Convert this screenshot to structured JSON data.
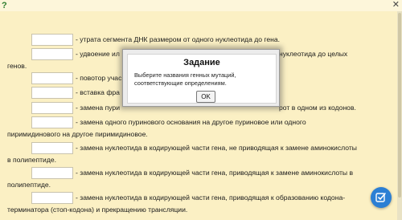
{
  "icons": {
    "help": "?",
    "close": "✕",
    "edit_check": "edit-check-icon"
  },
  "rows": [
    {
      "id": "r1",
      "text": "- утрата сегмента ДНК размером от одного нуклеотида до гена."
    },
    {
      "id": "r2",
      "text": "- удвоение ил",
      "hidden_tail": "нуклеотида до целых"
    },
    {
      "id": "r2b",
      "text": "генов."
    },
    {
      "id": "r3",
      "text": "- повотор учас"
    },
    {
      "id": "r4",
      "text": "- вставка фра"
    },
    {
      "id": "r5",
      "text": "- замена пури",
      "hidden_tail": "рот в одном из кодонов."
    },
    {
      "id": "r6",
      "text": "- замена одного пуринового основания на другое пуриновое или одного"
    },
    {
      "id": "r6b",
      "text": "пиримидинового на другое пиримидиновое."
    },
    {
      "id": "r7",
      "text": "- замена нуклеотида в кодирующей части гена, не приводящая к замене аминокислоты"
    },
    {
      "id": "r7b",
      "text": "в полипептиде."
    },
    {
      "id": "r8",
      "text": "- замена нуклеотида в кодирующей части гена, приводящая к замене аминокислоты в"
    },
    {
      "id": "r8b",
      "text": "полипептиде."
    },
    {
      "id": "r9",
      "text": "- замена нуклеотида в кодирующей части гена, приводящая к образованию кодона-"
    },
    {
      "id": "r9b",
      "text": "терминатора (стоп-кодона) и прекращению трансляции."
    }
  ],
  "dialog": {
    "title": "Задание",
    "text": "Выберите названия генных мутаций, соответствующие определениям.",
    "ok_label": "OK"
  },
  "colors": {
    "background": "#fbf0c4",
    "accent": "#2b7fd4"
  }
}
